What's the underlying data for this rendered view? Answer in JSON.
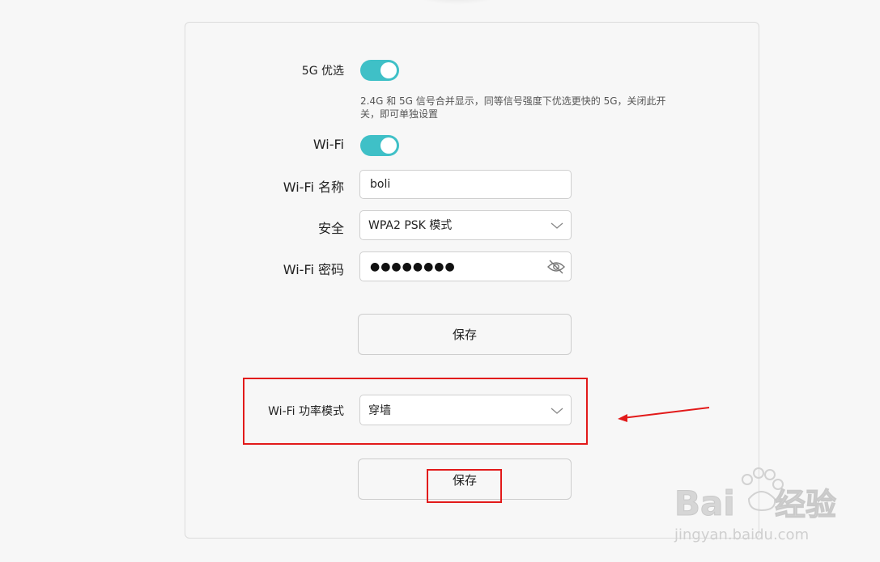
{
  "settings": {
    "band_pref_label": "5G 优选",
    "band_pref_hint": "2.4G 和 5G 信号合并显示，同等信号强度下优选更快的 5G，关闭此开关，即可单独设置",
    "band_pref_on": true,
    "wifi_label": "Wi-Fi",
    "wifi_on": true,
    "ssid_label": "Wi-Fi 名称",
    "ssid_value": "boli",
    "security_label": "安全",
    "security_value": "WPA2 PSK 模式",
    "password_label": "Wi-Fi 密码",
    "password_mask": "●●●●●●●●",
    "save_label": "保存"
  },
  "power": {
    "label": "Wi-Fi 功率模式",
    "value": "穿墙",
    "save_label": "保存"
  },
  "watermark": {
    "brand": "Baidu",
    "brand_cn": "经验",
    "url": "jingyan.baidu.com"
  },
  "colors": {
    "toggle_on": "#3fc0c7",
    "annotation_red": "#e21a1a"
  }
}
